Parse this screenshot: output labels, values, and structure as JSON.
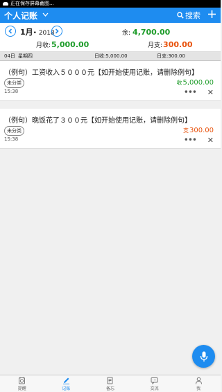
{
  "status_bar": {
    "text": "正在保存屏幕截图..."
  },
  "app_bar": {
    "title": "个人记账",
    "search_label": "搜索",
    "add_icon": "+"
  },
  "summary": {
    "month": "1月",
    "year": "• 2018",
    "balance_label": "余:",
    "balance_value": "4,700.00",
    "income_label": "月收:",
    "income_value": "5,000.00",
    "expense_label": "月支:",
    "expense_value": "300.00"
  },
  "day_header": {
    "date": "04日",
    "weekday": "星期四",
    "day_income": "日收:5,000.00",
    "day_expense": "日支:300.00"
  },
  "entries": [
    {
      "title": "（例句）工资收入５０００元【如开始使用记账，请删除例句】",
      "tag": "未分类",
      "kind": "收",
      "amount": "5,000.00",
      "time": "15:38",
      "color": "#1e9c2a"
    },
    {
      "title": "（例句）晚饭花了３００元【如开始使用记账，请删除例句】",
      "tag": "未分类",
      "kind": "支",
      "amount": "300.00",
      "time": "15:38",
      "color": "#e8520c"
    }
  ],
  "bottom_nav": [
    {
      "label": "提醒",
      "icon": "clock-icon",
      "active": false
    },
    {
      "label": "记账",
      "icon": "pen-icon",
      "active": true
    },
    {
      "label": "备忘",
      "icon": "note-icon",
      "active": false
    },
    {
      "label": "交流",
      "icon": "chat-icon",
      "active": false
    },
    {
      "label": "我",
      "icon": "person-icon",
      "active": false
    }
  ],
  "colors": {
    "accent": "#1e8cf0",
    "income": "#1e9c2a",
    "expense": "#e8520c"
  }
}
